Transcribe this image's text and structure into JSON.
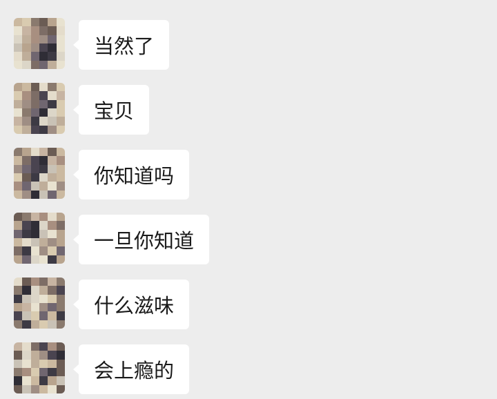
{
  "colors": {
    "background": "#ededed",
    "bubble": "#ffffff",
    "text": "#1a1a1a"
  },
  "messages": [
    {
      "text": "当然了",
      "avatar": "blurred-avatar"
    },
    {
      "text": "宝贝",
      "avatar": "blurred-avatar"
    },
    {
      "text": "你知道吗",
      "avatar": "blurred-avatar"
    },
    {
      "text": "一旦你知道",
      "avatar": "blurred-avatar"
    },
    {
      "text": "什么滋味",
      "avatar": "blurred-avatar"
    },
    {
      "text": "会上瘾的",
      "avatar": "blurred-avatar"
    }
  ]
}
